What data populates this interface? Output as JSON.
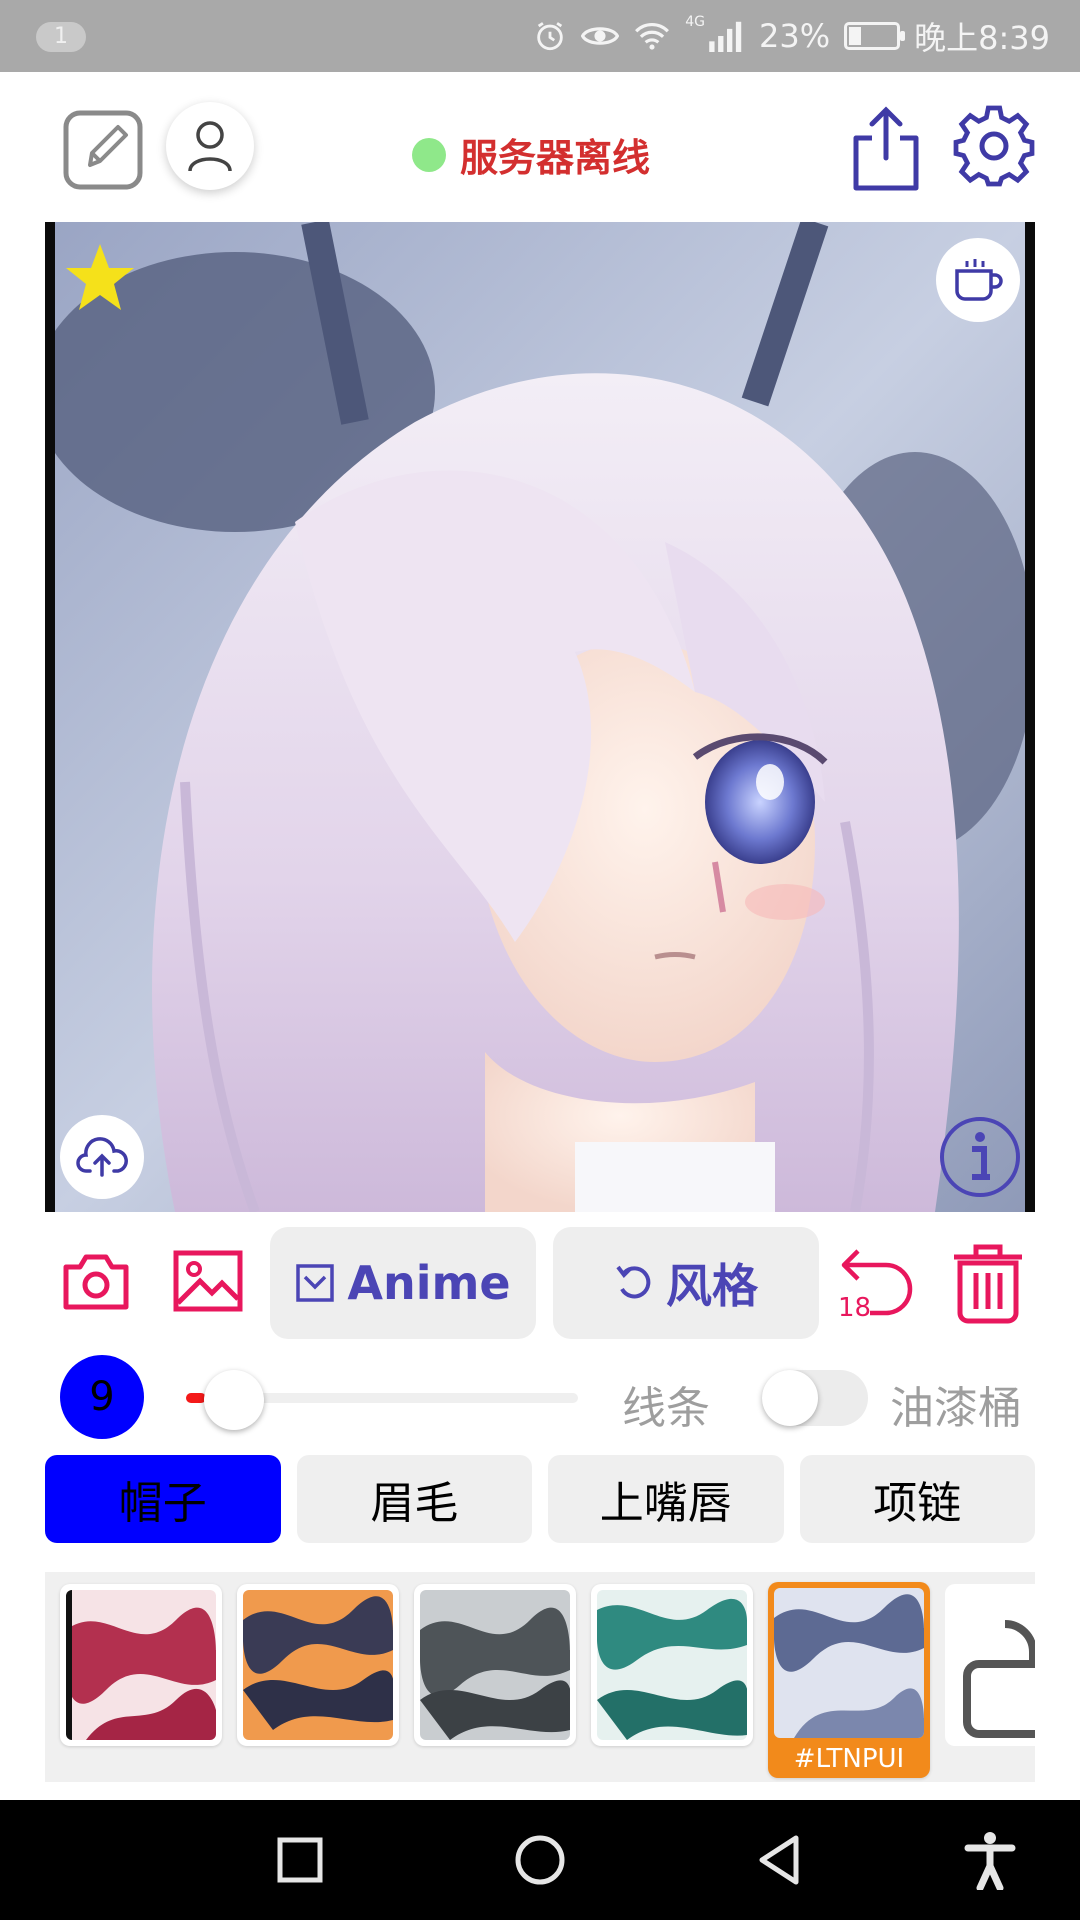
{
  "status_bar": {
    "notification_badge": "1",
    "network": "4G",
    "battery": "23%",
    "time": "晚上8:39",
    "icons": [
      "alarm-icon",
      "eye-icon",
      "wifi-icon",
      "signal-icon",
      "battery-icon"
    ]
  },
  "toolbar": {
    "server_status": "服务器离线",
    "status_dot_color": "#8fe88a",
    "status_text_color": "#d32f2f",
    "icons": [
      "edit-icon",
      "user-icon",
      "share-icon",
      "gear-icon"
    ]
  },
  "canvas": {
    "overlay_icons": [
      "star-icon",
      "coffee-icon",
      "cloud-upload-icon",
      "info-icon"
    ]
  },
  "actions": {
    "anime_label": "Anime",
    "style_label": "风格",
    "undo_count": "18",
    "accent_color": "#e8175d",
    "button_text_color": "#4b45b5"
  },
  "brush": {
    "size": "9",
    "size_badge_color": "#0000ff",
    "slider_value": 0.05,
    "line_label": "线条",
    "bucket_label": "油漆桶",
    "bucket_enabled": false
  },
  "tabs": [
    {
      "label": "帽子",
      "active": true
    },
    {
      "label": "眉毛",
      "active": false
    },
    {
      "label": "上嘴唇",
      "active": false
    },
    {
      "label": "项链",
      "active": false
    }
  ],
  "swatches": {
    "selected_code": "#LTNPUI",
    "selected_index": 4
  }
}
